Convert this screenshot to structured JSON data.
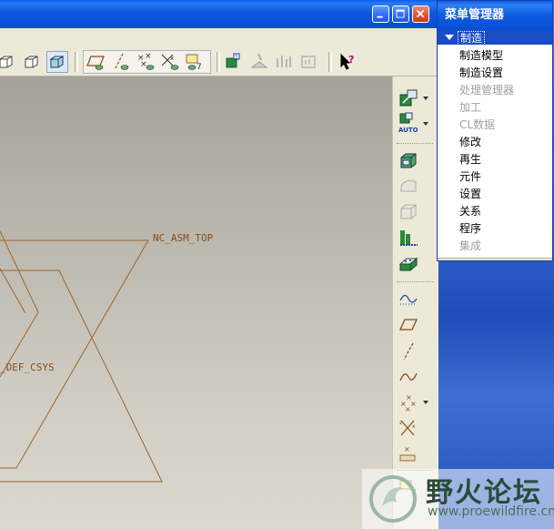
{
  "window": {
    "minimize_icon": "minimize-icon",
    "maximize_icon": "maximize-icon",
    "close_icon": "close-icon"
  },
  "colors": {
    "titlebar": "#0a5ee6",
    "datum": "#a0622a",
    "menu_header": "#1a4cc4",
    "disabled_text": "#a0a0a0"
  },
  "toolbar": {
    "icons": [
      "view-box-icon",
      "view-box-icon",
      "shaded-view-icon",
      "datum-plane-display-icon",
      "datum-axis-display-icon",
      "datum-point-display-icon",
      "coordinate-system-display-icon",
      "annotation-display-icon",
      "mfg-sequence-icon",
      "material-removal-icon",
      "nc-check-icon",
      "nc-output-icon",
      "context-help-icon"
    ]
  },
  "right_toolbar": {
    "icons": [
      "workcell-icon",
      "auto-icon",
      "mill-window-icon",
      "mill-surface-icon",
      "volume-icon",
      "profile-icon",
      "hole-group-icon",
      "sketch-curve-icon",
      "datum-plane-tool-icon",
      "datum-axis-tool-icon",
      "datum-curve-tool-icon",
      "datum-point-tool-icon",
      "csys-tool-icon",
      "datum-analysis-icon",
      "annotation-tool-icon"
    ]
  },
  "graphics": {
    "top_label": "NC_ASM_TOP",
    "csys_label": "_DEF_CSYS"
  },
  "menu_manager": {
    "title": "菜单管理器",
    "header": "制造",
    "items": [
      {
        "label": "制造模型",
        "enabled": true
      },
      {
        "label": "制造设置",
        "enabled": true
      },
      {
        "label": "处理管理器",
        "enabled": false
      },
      {
        "label": "加工",
        "enabled": false
      },
      {
        "label": "CL数据",
        "enabled": false
      },
      {
        "label": "修改",
        "enabled": true
      },
      {
        "label": "再生",
        "enabled": true
      },
      {
        "label": "元件",
        "enabled": true
      },
      {
        "label": "设置",
        "enabled": true
      },
      {
        "label": "关系",
        "enabled": true
      },
      {
        "label": "程序",
        "enabled": true
      },
      {
        "label": "集成",
        "enabled": false
      }
    ]
  },
  "watermark": {
    "title": "野火论坛",
    "url": "www.proewildfire.cn"
  }
}
